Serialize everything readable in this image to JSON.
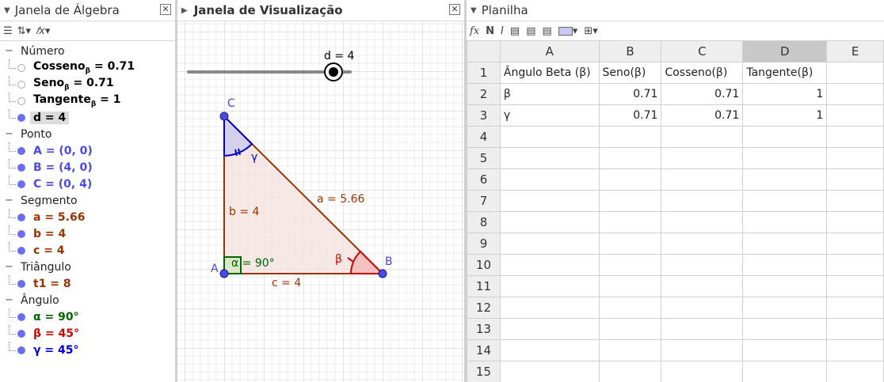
{
  "algebra": {
    "title": "Janela de Álgebra",
    "categories": [
      {
        "name": "Número",
        "items": [
          {
            "label": "Cosseno",
            "sub": "β",
            "value": " = 0.71",
            "shown": false,
            "color": "#000000"
          },
          {
            "label": "Seno",
            "sub": "β",
            "value": " = 0.71",
            "shown": false,
            "color": "#000000"
          },
          {
            "label": "Tangente",
            "sub": "β",
            "value": " = 1",
            "shown": false,
            "color": "#000000"
          },
          {
            "label": "d = 4",
            "sub": "",
            "value": "",
            "shown": true,
            "color": "#000000",
            "selected": true
          }
        ]
      },
      {
        "name": "Ponto",
        "items": [
          {
            "label": "A = (0, 0)",
            "color": "#4a4ae8",
            "shown": true
          },
          {
            "label": "B = (4, 0)",
            "color": "#4a4ae8",
            "shown": true
          },
          {
            "label": "C = (0, 4)",
            "color": "#4a4ae8",
            "shown": true
          }
        ]
      },
      {
        "name": "Segmento",
        "items": [
          {
            "label": "a = 5.66",
            "color": "#993300",
            "shown": true
          },
          {
            "label": "b = 4",
            "color": "#993300",
            "shown": true
          },
          {
            "label": "c = 4",
            "color": "#993300",
            "shown": true
          }
        ]
      },
      {
        "name": "Triângulo",
        "items": [
          {
            "label": "t1 = 8",
            "color": "#993300",
            "shown": true
          }
        ]
      },
      {
        "name": "Ângulo",
        "items": [
          {
            "label": "α = 90°",
            "color": "#006400",
            "shown": true
          },
          {
            "label": "β = 45°",
            "color": "#cc0000",
            "shown": true
          },
          {
            "label": "γ = 45°",
            "color": "#0000cc",
            "shown": true
          }
        ]
      }
    ]
  },
  "graphics": {
    "title": "Janela de Visualização",
    "slider_label": "d = 4",
    "slider_value": 4,
    "labels": {
      "A": "A",
      "B": "B",
      "C": "C",
      "seg_a": "a = 5.66",
      "seg_b": "b = 4",
      "seg_c": "c = 4",
      "alpha": "α = 90°",
      "beta": "β",
      "gamma": "γ"
    }
  },
  "spreadsheet": {
    "title": "Planilha",
    "toolbar": {
      "fx": "fx",
      "bold": "N",
      "italic": "I"
    },
    "columns": [
      "A",
      "B",
      "C",
      "D",
      "E"
    ],
    "selected_column": "D",
    "row_numbers": [
      "1",
      "2",
      "3",
      "4",
      "5",
      "6",
      "7",
      "8",
      "9",
      "10",
      "11",
      "12",
      "13",
      "14",
      "15"
    ],
    "rows": [
      [
        "Ângulo Beta (β)",
        "Seno(β)",
        "Cosseno(β)",
        "Tangente(β)",
        ""
      ],
      [
        "β",
        "0.71",
        "0.71",
        "1",
        ""
      ],
      [
        "γ",
        "0.71",
        "0.71",
        "1",
        ""
      ]
    ]
  },
  "colors": {
    "point": "#4a4ae8",
    "segment": "#993300",
    "triangle_fill": "#f3e0dc",
    "alpha": "#006400",
    "beta": "#cc0000",
    "gamma": "#0000cc"
  }
}
